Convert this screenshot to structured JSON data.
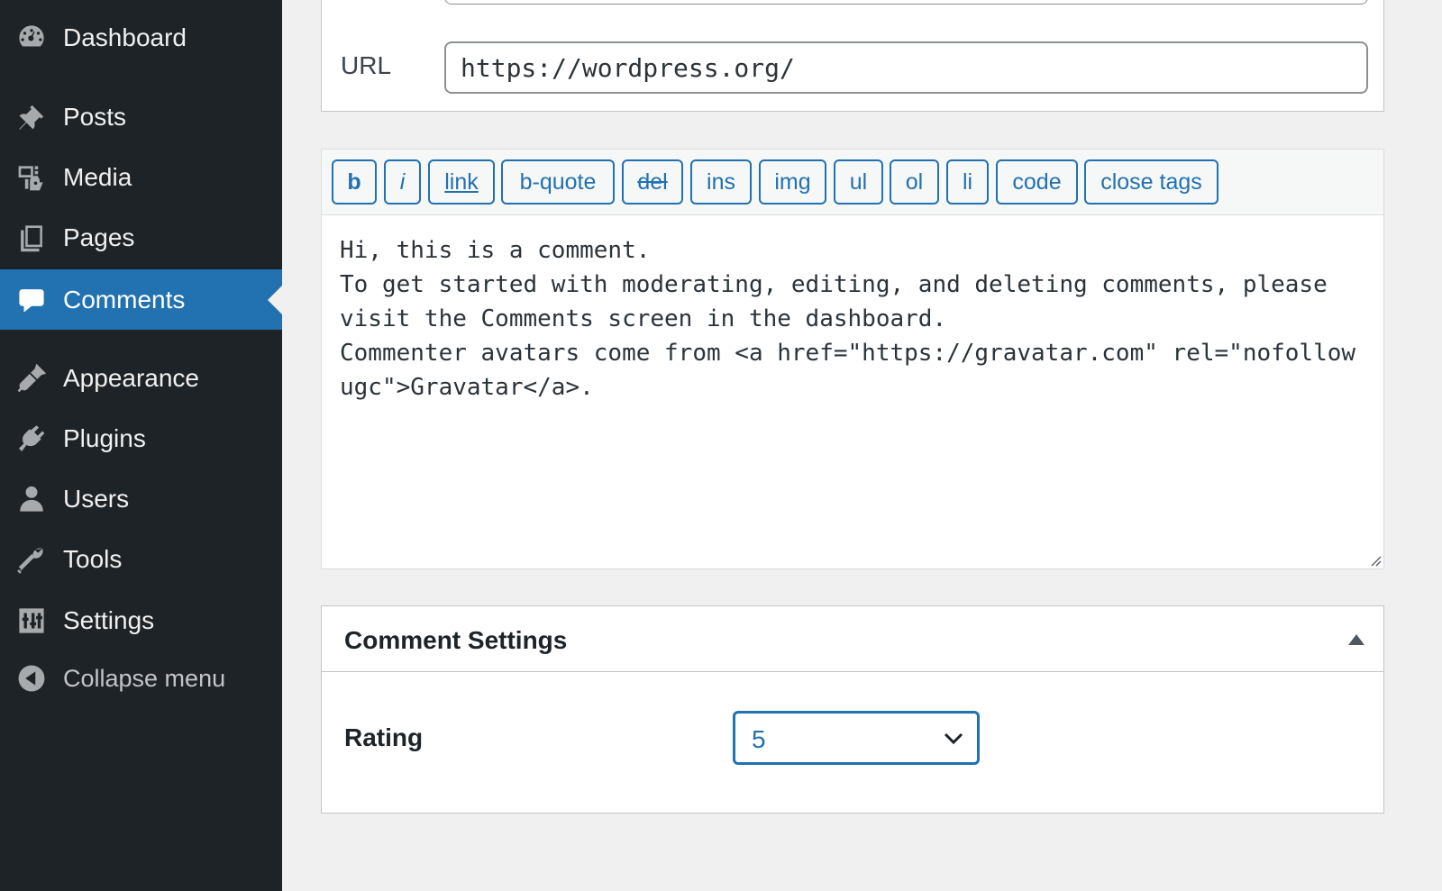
{
  "sidebar": {
    "items": [
      {
        "label": "Dashboard",
        "icon": "dashboard-icon"
      },
      {
        "label": "Posts",
        "icon": "pin-icon"
      },
      {
        "label": "Media",
        "icon": "media-icon"
      },
      {
        "label": "Pages",
        "icon": "pages-icon"
      },
      {
        "label": "Comments",
        "icon": "comment-icon",
        "current": true
      },
      {
        "label": "Appearance",
        "icon": "brush-icon"
      },
      {
        "label": "Plugins",
        "icon": "plugin-icon"
      },
      {
        "label": "Users",
        "icon": "user-icon"
      },
      {
        "label": "Tools",
        "icon": "wrench-icon"
      },
      {
        "label": "Settings",
        "icon": "settings-sliders-icon"
      }
    ],
    "collapse_label": "Collapse menu",
    "colors": {
      "background": "#1d2327",
      "current": "#2271b1",
      "text": "#f0f0f1",
      "icon": "#a7aaad"
    }
  },
  "url_field": {
    "label": "URL",
    "value": "https://wordpress.org/"
  },
  "editor": {
    "toolbar": [
      "b",
      "i",
      "link",
      "b-quote",
      "del",
      "ins",
      "img",
      "ul",
      "ol",
      "li",
      "code",
      "close tags"
    ],
    "content": "Hi, this is a comment.\nTo get started with moderating, editing, and deleting comments, please visit the Comments screen in the dashboard.\nCommenter avatars come from <a href=\"https://gravatar.com\" rel=\"nofollow ugc\">Gravatar</a>."
  },
  "comment_settings": {
    "title": "Comment Settings",
    "rating_label": "Rating",
    "rating_value": "5"
  },
  "accent_color": "#2271b1"
}
